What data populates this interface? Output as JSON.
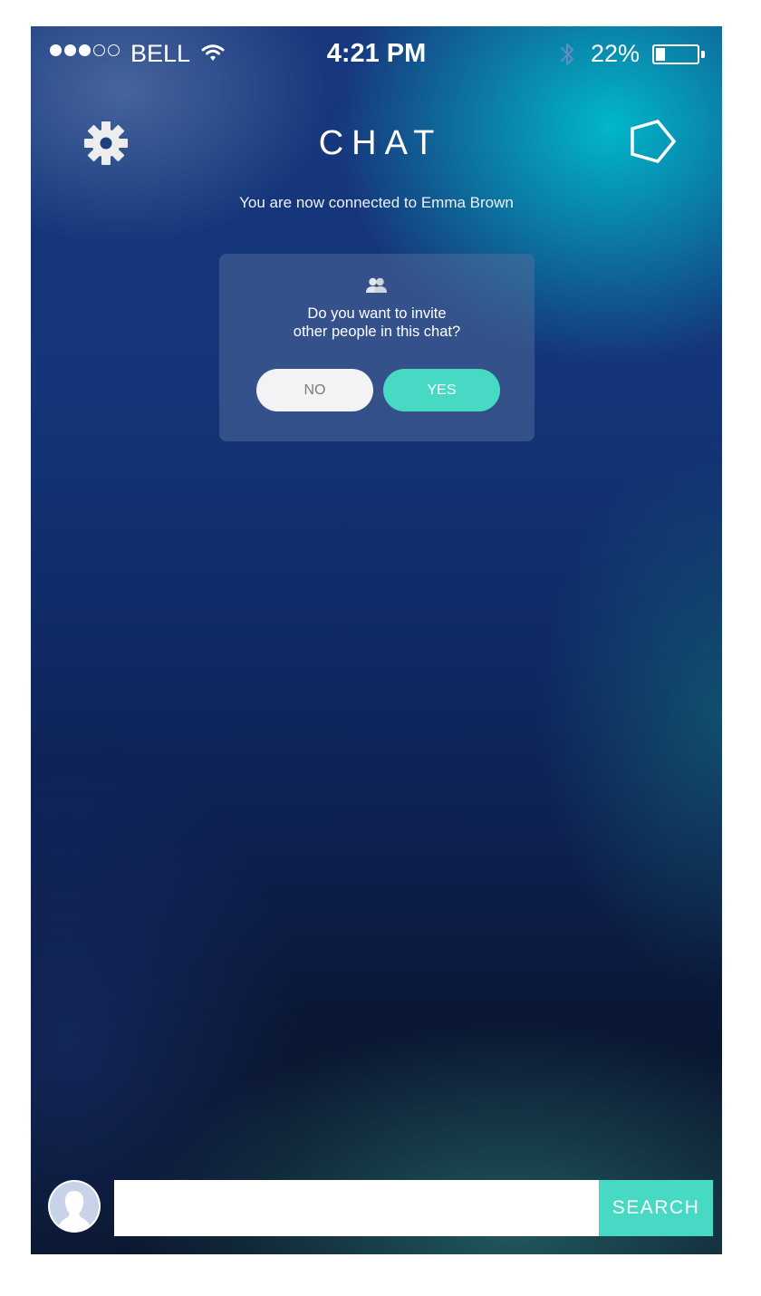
{
  "status_bar": {
    "signal_bars_filled": 3,
    "signal_bars_total": 5,
    "carrier": "BELL",
    "time": "4:21 PM",
    "battery_percent_label": "22%",
    "battery_level": 0.22,
    "icons": [
      "wifi-icon",
      "bluetooth-icon",
      "battery-icon"
    ]
  },
  "header": {
    "title": "CHAT",
    "left_icon": "gear-icon",
    "right_icon": "pentagon-icon"
  },
  "connection_message": "You are now connected to Emma Brown",
  "invite_dialog": {
    "icon": "people-icon",
    "question_line1": "Do you want to invite",
    "question_line2": "other people in this chat?",
    "no_label": "NO",
    "yes_label": "YES"
  },
  "bottom_bar": {
    "avatar_icon": "user-avatar-icon",
    "search_value": "",
    "search_placeholder": "",
    "search_button_label": "SEARCH"
  },
  "colors": {
    "accent": "#47d9c3",
    "background_top": "#143579",
    "background_bottom": "#0a1426",
    "no_button": "#f3f3f5"
  }
}
